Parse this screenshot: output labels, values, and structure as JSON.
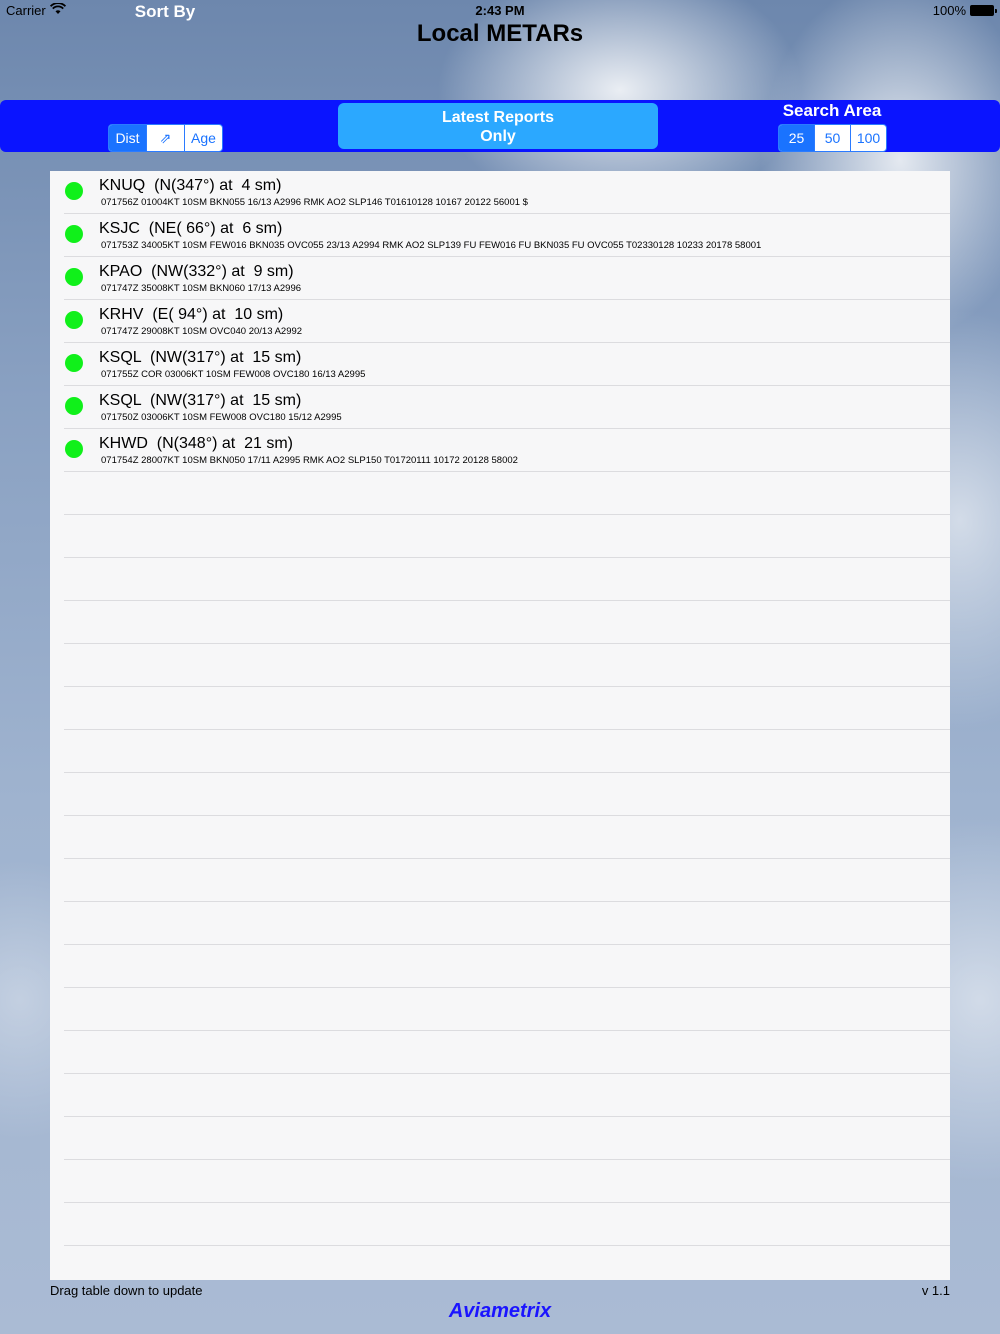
{
  "status_bar": {
    "carrier": "Carrier",
    "time": "2:43 PM",
    "battery": "100%"
  },
  "title": "Local METARs",
  "toolbar": {
    "sort_label": "Sort By",
    "sort_options": [
      "Dist",
      "⇗",
      "Age"
    ],
    "sort_selected": "Dist",
    "latest_button": "Latest Reports\nOnly",
    "area_label": "Search Area",
    "area_options": [
      "25",
      "50",
      "100"
    ],
    "area_selected": "25"
  },
  "reports": [
    {
      "station": "KNUQ",
      "bearing": "(N(347°) at  4 sm)",
      "metar": "071756Z 01004KT 10SM BKN055 16/13 A2996 RMK AO2 SLP146 T01610128 10167 20122 56001 $",
      "status_color": "#10f01a"
    },
    {
      "station": "KSJC",
      "bearing": "(NE( 66°) at  6 sm)",
      "metar": "071753Z 34005KT 10SM FEW016 BKN035 OVC055 23/13 A2994 RMK AO2 SLP139 FU FEW016 FU BKN035 FU OVC055 T02330128 10233 20178 58001",
      "status_color": "#10f01a"
    },
    {
      "station": "KPAO",
      "bearing": "(NW(332°) at  9 sm)",
      "metar": "071747Z 35008KT 10SM BKN060 17/13 A2996",
      "status_color": "#10f01a"
    },
    {
      "station": "KRHV",
      "bearing": "(E( 94°) at  10 sm)",
      "metar": "071747Z 29008KT 10SM OVC040 20/13 A2992",
      "status_color": "#10f01a"
    },
    {
      "station": "KSQL",
      "bearing": "(NW(317°) at  15 sm)",
      "metar": "071755Z COR 03006KT 10SM FEW008 OVC180 16/13 A2995",
      "status_color": "#10f01a"
    },
    {
      "station": "KSQL",
      "bearing": "(NW(317°) at  15 sm)",
      "metar": "071750Z 03006KT 10SM FEW008 OVC180 15/12 A2995",
      "status_color": "#10f01a"
    },
    {
      "station": "KHWD",
      "bearing": "(N(348°) at  21 sm)",
      "metar": "071754Z 28007KT 10SM BKN050 17/11 A2995 RMK AO2 SLP150 T01720111 10172 20128 58002",
      "status_color": "#10f01a"
    }
  ],
  "footer": {
    "hint": "Drag table down to update",
    "version": "v 1.1",
    "brand": "Aviametrix"
  }
}
